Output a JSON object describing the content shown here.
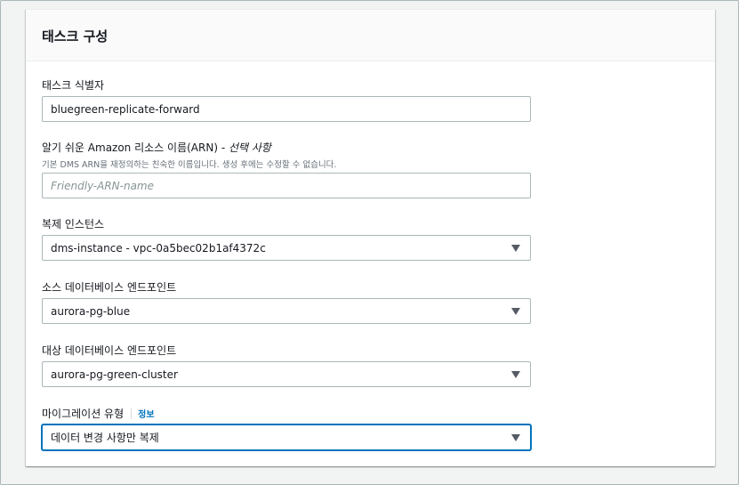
{
  "panel": {
    "title": "태스크 구성"
  },
  "fields": {
    "task_id": {
      "label": "태스크 식별자",
      "value": "bluegreen-replicate-forward"
    },
    "arn": {
      "label": "알기 쉬운 Amazon 리소스 이름(ARN) - ",
      "optional": "선택 사항",
      "description": "기본 DMS ARN을 재정의하는 친숙한 이름입니다. 생성 후에는 수정할 수 없습니다.",
      "placeholder": "Friendly-ARN-name"
    },
    "replication_instance": {
      "label": "복제 인스턴스",
      "value": "dms-instance - vpc-0a5bec02b1af4372c"
    },
    "source_endpoint": {
      "label": "소스 데이터베이스 엔드포인트",
      "value": "aurora-pg-blue"
    },
    "target_endpoint": {
      "label": "대상 데이터베이스 엔드포인트",
      "value": "aurora-pg-green-cluster"
    },
    "migration_type": {
      "label": "마이그레이션 유형",
      "info_link": "정보",
      "value": "데이터 변경 사항만 복제"
    }
  }
}
